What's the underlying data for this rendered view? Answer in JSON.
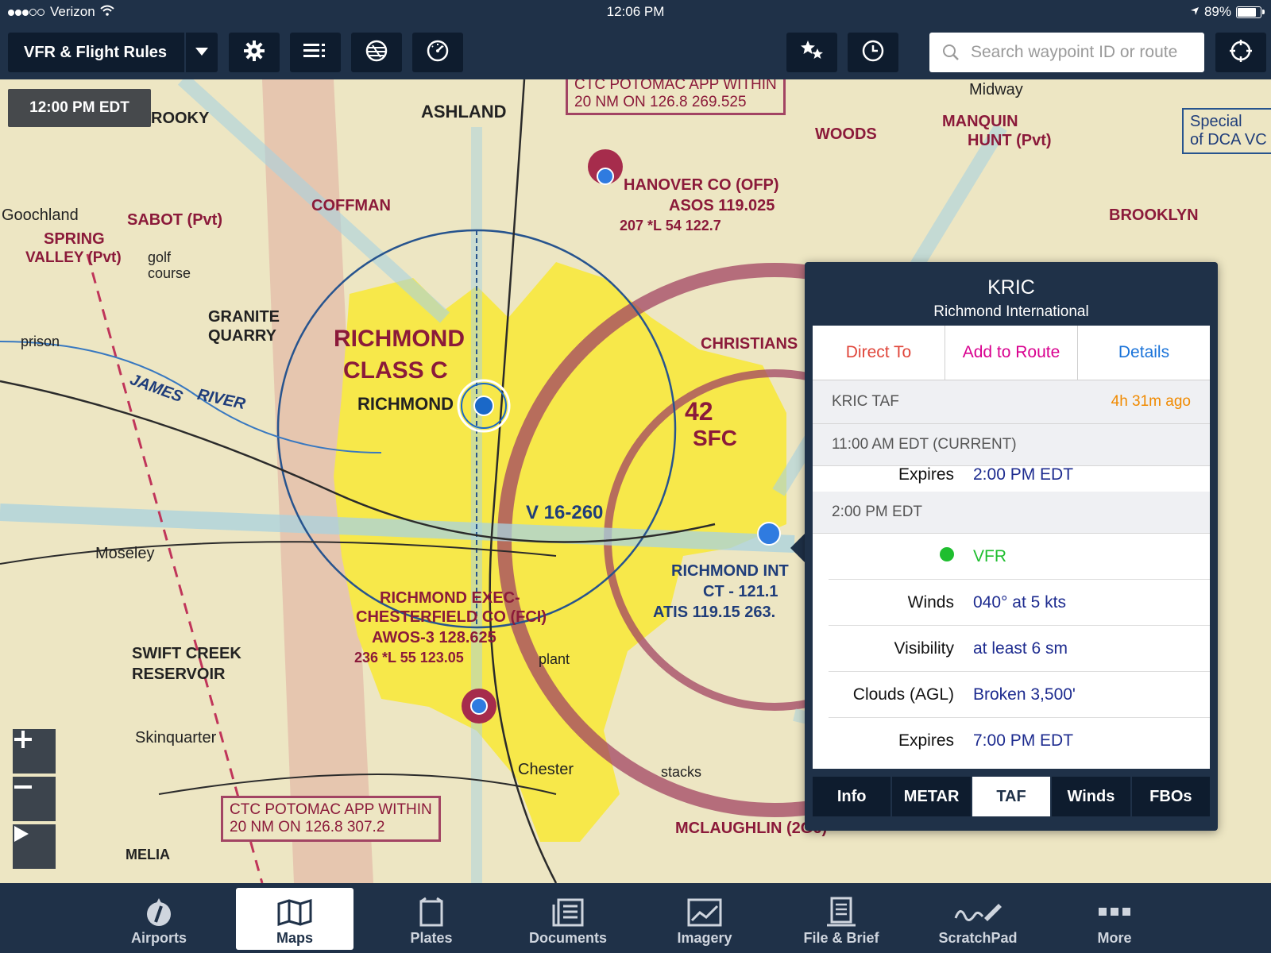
{
  "status": {
    "carrier": "Verizon",
    "time": "12:06 PM",
    "battery": "89%",
    "battery_level": 0.89
  },
  "toolbar": {
    "layer_label": "VFR & Flight Rules",
    "search_placeholder": "Search waypoint ID or route"
  },
  "map": {
    "time_label": "12:00 PM EDT",
    "labels": {
      "richmond_class_c": "RICHMOND",
      "class_c": "CLASS C",
      "richmond": "RICHMOND",
      "ashland": "ASHLAND",
      "goochland": "Goochland",
      "granite": "GRANITE",
      "quarry": "QUARRY",
      "hanover": "HANOVER CO (OFP)",
      "asos": "ASOS 119.025",
      "hanover_freq": "207 *L 54 122.7",
      "coffman": "COFFMAN",
      "sabot": "SABOT (Pvt)",
      "spring_valley": "SPRING",
      "valley": "VALLEY (Pvt)",
      "woods": "WOODS",
      "manquin": "MANQUIN",
      "hunt": "HUNT (Pvt)",
      "midway": "Midway",
      "brooklyn": "BROOKLYN",
      "christians": "CHRISTIANS",
      "richmond_int": "RICHMOND INT",
      "ct": "CT - 121.1",
      "atis": "ATIS 119.15 263.",
      "exec": "RICHMOND EXEC-",
      "chesterfield": "CHESTERFIELD CO (FCI)",
      "awos": "AWOS-3 128.625",
      "chesterfield_freq": "236 *L 55 123.05",
      "swift": "SWIFT CREEK",
      "reservoir": "RESERVOIR",
      "moseley": "Moseley",
      "skinquarter": "Skinquarter",
      "chester": "Chester",
      "mclaughlin": "MCLAUGHLIN (2G6)",
      "ctc_top_1": "CTC POTOMAC APP WITHIN",
      "ctc_top_2": "20 NM ON 126.8 269.525",
      "ctc_bot_1": "CTC POTOMAC APP WITHIN",
      "ctc_bot_2": "20 NM ON 126.8  307.2",
      "james": "JAMES",
      "river": "RIVER",
      "v16": "V 16-260",
      "special_1": "Special",
      "special_2": "of DCA VC",
      "sfc": "SFC",
      "altitude_42": "42",
      "rooky": "ROOKY",
      "melia": "MELIA",
      "stacks": "stacks",
      "golf": "golf",
      "course": "course",
      "prison": "prison",
      "plant": "plant"
    }
  },
  "popover": {
    "ident": "KRIC",
    "name": "Richmond International",
    "actions": {
      "direct": "Direct To",
      "add_route": "Add to Route",
      "details": "Details"
    },
    "taf_header": "KRIC TAF",
    "taf_age": "4h 31m ago",
    "period1": "11:00 AM EDT (CURRENT)",
    "period1_expires_label": "Expires",
    "period1_expires": "2:00 PM EDT",
    "period2": "2:00 PM EDT",
    "flight_rule": "VFR",
    "winds_label": "Winds",
    "winds": "040° at 5 kts",
    "visibility_label": "Visibility",
    "visibility": "at least 6 sm",
    "clouds_label": "Clouds (AGL)",
    "clouds": "Broken 3,500'",
    "expires_label": "Expires",
    "expires": "7:00 PM EDT",
    "tabs": {
      "info": "Info",
      "metar": "METAR",
      "taf": "TAF",
      "winds": "Winds",
      "fbos": "FBOs"
    }
  },
  "tabbar": {
    "airports": "Airports",
    "maps": "Maps",
    "plates": "Plates",
    "documents": "Documents",
    "imagery": "Imagery",
    "file_brief": "File & Brief",
    "scratchpad": "ScratchPad",
    "more": "More"
  },
  "colors": {
    "accent_red": "#e0463b",
    "accent_magenta": "#d9008f",
    "accent_blue": "#1a73d9",
    "age_orange": "#f08a00",
    "vfr_green": "#1fbe2f",
    "value_blue": "#1d2b8f"
  }
}
